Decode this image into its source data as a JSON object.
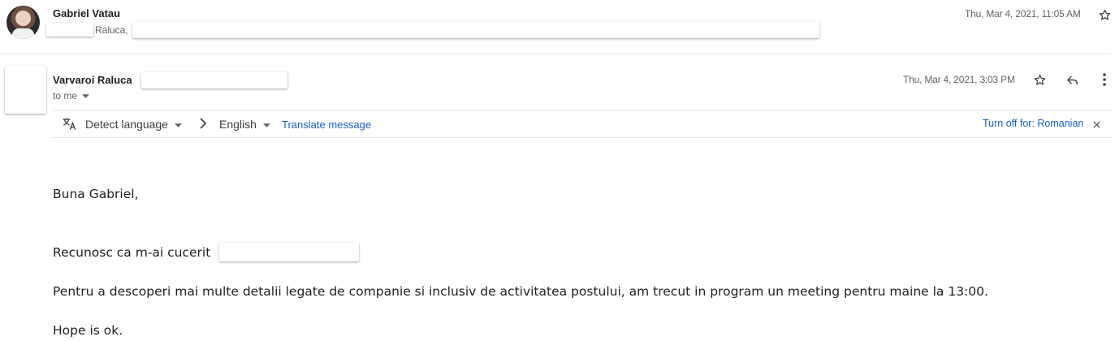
{
  "message1": {
    "sender": "Gabriel Vatau",
    "date": "Thu, Mar 4, 2021, 11:05 AM",
    "snippet": "Raluca,"
  },
  "message2": {
    "sender": "Varvaroi Raluca",
    "date": "Thu, Mar 4, 2021, 3:03 PM",
    "recipient": "to me"
  },
  "translate_bar": {
    "source_language": "Detect language",
    "target_language": "English",
    "translate_link": "Translate message",
    "turn_off": "Turn off for: Romanian"
  },
  "body": {
    "greeting": "Buna Gabriel,",
    "line1": "Recunosc ca m-ai cucerit",
    "line2": "Pentru a descoperi mai multe detalii legate de companie si inclusiv de activitatea postului, am trecut in program un meeting pentru maine la 13:00.",
    "line3": "Hope is ok."
  },
  "icons": {
    "star": "star-icon",
    "reply": "reply-icon",
    "more": "more-vert-icon",
    "translate": "translate-icon",
    "dropdown": "caret-down-icon",
    "arrow": "chevron-right-icon",
    "close": "close-icon"
  }
}
